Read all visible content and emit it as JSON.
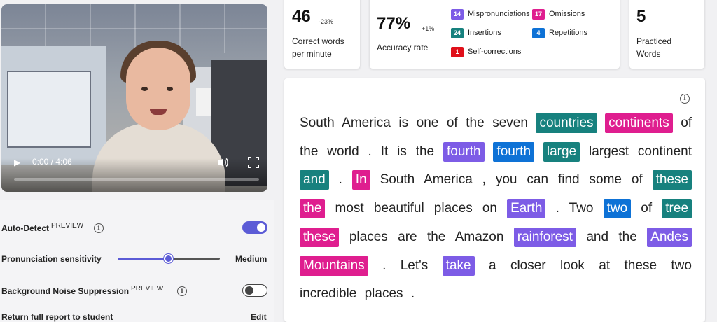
{
  "video": {
    "time": "0:00 / 4:06",
    "progress": 0
  },
  "settings": {
    "auto_detect": {
      "label": "Auto-Detect",
      "tag": "PREVIEW",
      "enabled": true
    },
    "sensitivity": {
      "label": "Pronunciation sensitivity",
      "value": "Medium",
      "level": 0.5
    },
    "noise": {
      "label": "Background Noise Suppression",
      "tag": "PREVIEW",
      "enabled": false
    },
    "report": {
      "label": "Return full report to student",
      "action": "Edit"
    }
  },
  "stats": {
    "wpm": {
      "value": "46",
      "delta": "-23%",
      "label_line1": "Correct words",
      "label_line2": "per minute"
    },
    "accuracy": {
      "value": "77%",
      "delta": "+1%",
      "label": "Accuracy rate"
    },
    "practiced": {
      "value": "5",
      "label_line1": "Practiced",
      "label_line2": "Words"
    }
  },
  "legend": {
    "mispronunciations": {
      "count": "14",
      "label": "Mispronunciations",
      "color": "#7d5ce6"
    },
    "omissions": {
      "count": "17",
      "label": "Omissions",
      "color": "#df1e8f"
    },
    "insertions": {
      "count": "24",
      "label": "Insertions",
      "color": "#17817e"
    },
    "repetitions": {
      "count": "4",
      "label": "Repetitions",
      "color": "#0e72d6"
    },
    "self_corrections": {
      "count": "1",
      "label": "Self-corrections",
      "color": "#e0101a"
    }
  },
  "passage": {
    "tokens": [
      {
        "t": "South"
      },
      {
        "t": "America"
      },
      {
        "t": "is"
      },
      {
        "t": "one"
      },
      {
        "t": "of"
      },
      {
        "t": "the"
      },
      {
        "t": "seven"
      },
      {
        "t": "countries",
        "c": "ins"
      },
      {
        "t": "continents",
        "c": "omi"
      },
      {
        "t": "of"
      },
      {
        "t": "the"
      },
      {
        "t": "world"
      },
      {
        "t": "."
      },
      {
        "t": "It"
      },
      {
        "t": "is"
      },
      {
        "t": "the"
      },
      {
        "t": "fourth",
        "c": "mis"
      },
      {
        "t": "fourth",
        "c": "rep"
      },
      {
        "t": "large",
        "c": "ins"
      },
      {
        "t": "largest"
      },
      {
        "t": "continent"
      },
      {
        "t": "and",
        "c": "ins"
      },
      {
        "t": "."
      },
      {
        "t": "In",
        "c": "omi"
      },
      {
        "t": "South"
      },
      {
        "t": "America"
      },
      {
        "t": ","
      },
      {
        "t": "you"
      },
      {
        "t": "can"
      },
      {
        "t": "find"
      },
      {
        "t": "some"
      },
      {
        "t": "of"
      },
      {
        "t": "these",
        "c": "ins"
      },
      {
        "t": "the",
        "c": "omi"
      },
      {
        "t": "most"
      },
      {
        "t": "beautiful"
      },
      {
        "t": "places"
      },
      {
        "t": "on"
      },
      {
        "t": "Earth",
        "c": "mis"
      },
      {
        "t": "."
      },
      {
        "t": "Two"
      },
      {
        "t": "two",
        "c": "rep"
      },
      {
        "t": "of"
      },
      {
        "t": "tree",
        "c": "ins"
      },
      {
        "t": "these",
        "c": "omi"
      },
      {
        "t": "places"
      },
      {
        "t": "are"
      },
      {
        "t": "the"
      },
      {
        "t": "Amazon"
      },
      {
        "t": "rainforest",
        "c": "mis"
      },
      {
        "t": "and"
      },
      {
        "t": "the"
      },
      {
        "t": "Andes",
        "c": "mis"
      },
      {
        "t": "Mountains",
        "c": "omi"
      },
      {
        "t": "."
      },
      {
        "t": "Let's"
      },
      {
        "t": "take",
        "c": "mis"
      },
      {
        "t": "a"
      },
      {
        "t": "closer"
      },
      {
        "t": "look"
      },
      {
        "t": "at"
      },
      {
        "t": "these"
      },
      {
        "t": "two"
      },
      {
        "t": "incredible"
      },
      {
        "t": "places"
      },
      {
        "t": "."
      }
    ]
  }
}
